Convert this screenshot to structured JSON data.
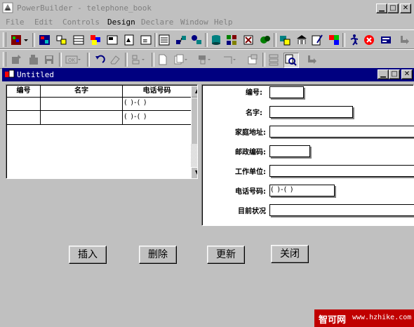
{
  "window": {
    "title": "PowerBuilder - telephone_book"
  },
  "menu": [
    "File",
    "Edit",
    "Controls",
    "Design",
    "Declare",
    "Window",
    "Help"
  ],
  "child_window": {
    "title": "Untitled"
  },
  "grid": {
    "headers": [
      "编号",
      "名字",
      "电话号码"
    ],
    "rows": [
      {
        "id": "",
        "name": "",
        "phone": "(  )-(     )"
      },
      {
        "id": "",
        "name": "",
        "phone": "(  )-(     )"
      }
    ]
  },
  "form": {
    "fields": [
      {
        "label": "编号:",
        "value": ""
      },
      {
        "label": "名字:",
        "value": ""
      },
      {
        "label": "家庭地址:",
        "value": ""
      },
      {
        "label": "邮政编码:",
        "value": ""
      },
      {
        "label": "工作单位:",
        "value": ""
      },
      {
        "label": "电话号码:",
        "value": "(  )-(     )"
      },
      {
        "label": "目前状况",
        "value": ""
      }
    ]
  },
  "buttons": {
    "insert": "插入",
    "delete": "删除",
    "update": "更新",
    "close": "关闭"
  },
  "watermark": {
    "site": "智可网",
    "url": "www.hzhike.com"
  },
  "colors": {
    "titlebar_active": "#000080",
    "face": "#c0c0c0",
    "watermark": "#c00000"
  }
}
